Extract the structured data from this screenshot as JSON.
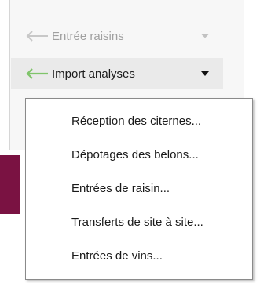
{
  "ribbon": {
    "disabled_item": {
      "label": "Entrée raisins",
      "icon": "left-arrow-icon",
      "arrow_color": "#c8c8c8"
    },
    "active_item": {
      "label": "Import analyses",
      "icon": "left-arrow-icon",
      "arrow_color": "#7fc46a"
    }
  },
  "menu": {
    "items": [
      {
        "label": "Réception des citernes..."
      },
      {
        "label": "Dépotages des belons..."
      },
      {
        "label": "Entrées de raisin..."
      },
      {
        "label": "Transferts de site à site..."
      },
      {
        "label": "Entrées de vins..."
      }
    ]
  },
  "colors": {
    "accent_bar": "#7a1242",
    "green_arrow": "#7fc46a",
    "disabled_text": "#a0a0a0"
  }
}
